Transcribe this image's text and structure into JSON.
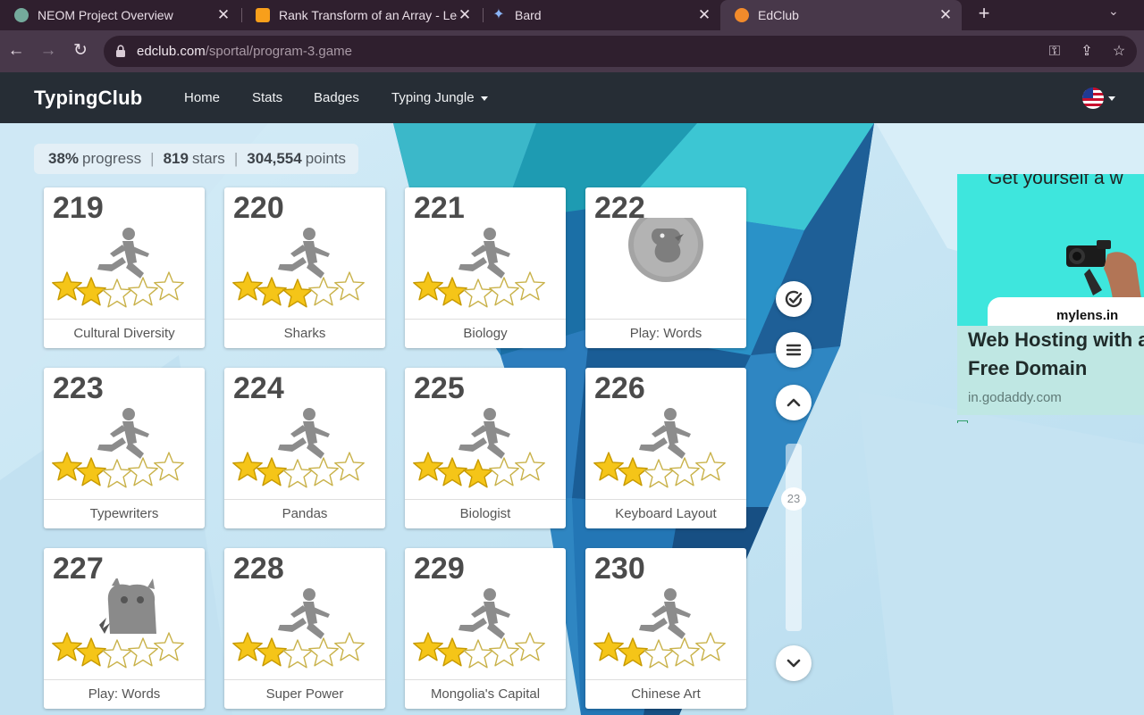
{
  "browser": {
    "tabs": [
      {
        "title": "NEOM Project Overview",
        "active": false,
        "favicon_color": "#74aa9c"
      },
      {
        "title": "Rank Transform of an Array - Lee",
        "active": false,
        "favicon_color": "#f89f1b"
      },
      {
        "title": "Bard",
        "active": false,
        "favicon_color": "#8ab4f8"
      },
      {
        "title": "EdClub",
        "active": true,
        "favicon_color": "#f28b2b"
      }
    ],
    "url_host": "edclub.com",
    "url_path": "/sportal/program-3.game"
  },
  "site": {
    "logo": "TypingClub",
    "nav": [
      {
        "label": "Home"
      },
      {
        "label": "Stats"
      },
      {
        "label": "Badges"
      },
      {
        "label": "Typing Jungle"
      }
    ]
  },
  "progress": {
    "percent": "38%",
    "percent_label": "progress",
    "stars": "819",
    "stars_label": "stars",
    "points": "304,554",
    "points_label": "points"
  },
  "lessons": [
    {
      "num": "219",
      "title": "Cultural Diversity",
      "icon": "runner-icon",
      "stars": 2
    },
    {
      "num": "220",
      "title": "Sharks",
      "icon": "runner-icon",
      "stars": 3
    },
    {
      "num": "221",
      "title": "Biology",
      "icon": "runner-icon",
      "stars": 2
    },
    {
      "num": "222",
      "title": "Play: Words",
      "icon": "chick-game-icon",
      "stars": 0
    },
    {
      "num": "223",
      "title": "Typewriters",
      "icon": "runner-icon",
      "stars": 2
    },
    {
      "num": "224",
      "title": "Pandas",
      "icon": "runner-icon",
      "stars": 2
    },
    {
      "num": "225",
      "title": "Biologist",
      "icon": "runner-icon",
      "stars": 3
    },
    {
      "num": "226",
      "title": "Keyboard Layout",
      "icon": "runner-icon",
      "stars": 2
    },
    {
      "num": "227",
      "title": "Play: Words",
      "icon": "monster-game-icon",
      "stars": 2
    },
    {
      "num": "228",
      "title": "Super Power",
      "icon": "runner-icon",
      "stars": 2
    },
    {
      "num": "229",
      "title": "Mongolia's Capital",
      "icon": "runner-icon",
      "stars": 2
    },
    {
      "num": "230",
      "title": "Chinese Art",
      "icon": "runner-icon",
      "stars": 2
    }
  ],
  "sidebar": {
    "scroll_position_label": "23"
  },
  "ad": {
    "tagline": "Get yourself a w",
    "brand": "mylens.in",
    "headline": "Web Hosting with a Free Domain",
    "domain": "in.godaddy.com"
  },
  "colors": {
    "star_gold": "#f5c518",
    "star_empty": "#ffffff",
    "nav_bg": "#262d35",
    "ad_teal": "#3ee6dd"
  }
}
